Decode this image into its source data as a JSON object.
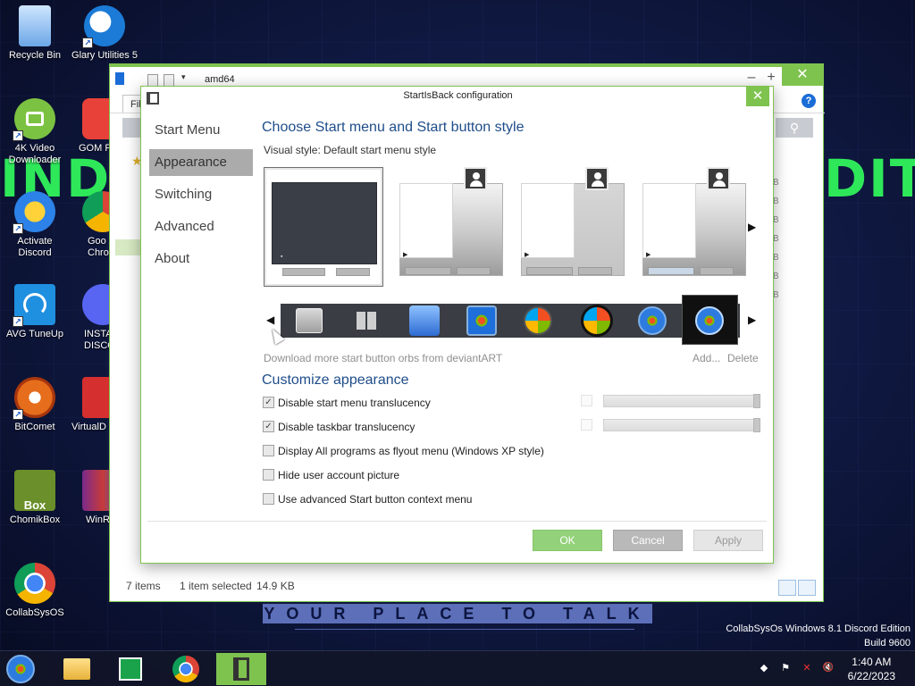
{
  "desktop": {
    "icons": [
      {
        "label": "Recycle Bin"
      },
      {
        "label": "Glary Utilities 5"
      },
      {
        "label": "4K Video Downloader"
      },
      {
        "label": "GOM P"
      },
      {
        "label": "Activate Discord"
      },
      {
        "label": "Goo Chro"
      },
      {
        "label": "AVG TuneUp"
      },
      {
        "label": "INSTA DISCO"
      },
      {
        "label": "BitComet"
      },
      {
        "label": "VirtualD"
      },
      {
        "label": "ChomikBox"
      },
      {
        "label": "WinR"
      },
      {
        "label": "CollabSysOS"
      }
    ],
    "wallpaper_left_text": "IND",
    "wallpaper_right_text": "DIT",
    "slogan": "YOUR PLACE TO TALK",
    "watermark_line1": "CollabSysOs Windows 8.1 Discord Edition",
    "watermark_line2": "Build 9600",
    "chomik_badge": "Box"
  },
  "explorer": {
    "title": "amd64",
    "ribbon_tab": "Fil",
    "min_glyph": "–",
    "max_glyph": "+",
    "close_glyph": "✕",
    "help_glyph": "?",
    "search_glyph": "⚲",
    "sizes": [
      "B",
      "B",
      "B",
      "B",
      "B",
      "B",
      "B"
    ],
    "status_items": "7 items",
    "status_selected": "1 item selected",
    "status_size": "14.9 KB"
  },
  "dialog": {
    "title": "StartIsBack configuration",
    "close_glyph": "✕",
    "nav": [
      {
        "label": "Start Menu",
        "selected": false
      },
      {
        "label": "Appearance",
        "selected": true
      },
      {
        "label": "Switching",
        "selected": false
      },
      {
        "label": "Advanced",
        "selected": false
      },
      {
        "label": "About",
        "selected": false
      }
    ],
    "style_heading": "Choose Start menu and Start button style",
    "visual_style_label": "Visual style:",
    "visual_style_value": "Default start menu style",
    "thumb_nav_next": "▶",
    "orb_nav_prev": "◀",
    "orb_nav_next": "▶",
    "orb_selected_index": 7,
    "download_link": "Download more start button orbs from deviantART",
    "add_link": "Add...",
    "delete_link": "Delete",
    "customize_heading": "Customize appearance",
    "options": [
      {
        "label": "Disable start menu translucency",
        "checked": true,
        "has_slider": true
      },
      {
        "label": "Disable taskbar translucency",
        "checked": true,
        "has_slider": true
      },
      {
        "label": "Display All programs as flyout menu (Windows XP style)",
        "checked": false,
        "has_slider": false
      },
      {
        "label": "Hide user account picture",
        "checked": false,
        "has_slider": false
      },
      {
        "label": "Use advanced Start button context menu",
        "checked": false,
        "has_slider": false
      }
    ],
    "check_glyph": "✓",
    "ok_label": "OK",
    "cancel_label": "Cancel",
    "apply_label": "Apply"
  },
  "taskbar": {
    "time": "1:40 AM",
    "date": "6/22/2023",
    "tray_glyphs": [
      "◆",
      "⚑",
      "✕",
      "🔇"
    ]
  },
  "colors": {
    "accent_green": "#7fc34f",
    "heading_blue": "#1f4d8a"
  }
}
